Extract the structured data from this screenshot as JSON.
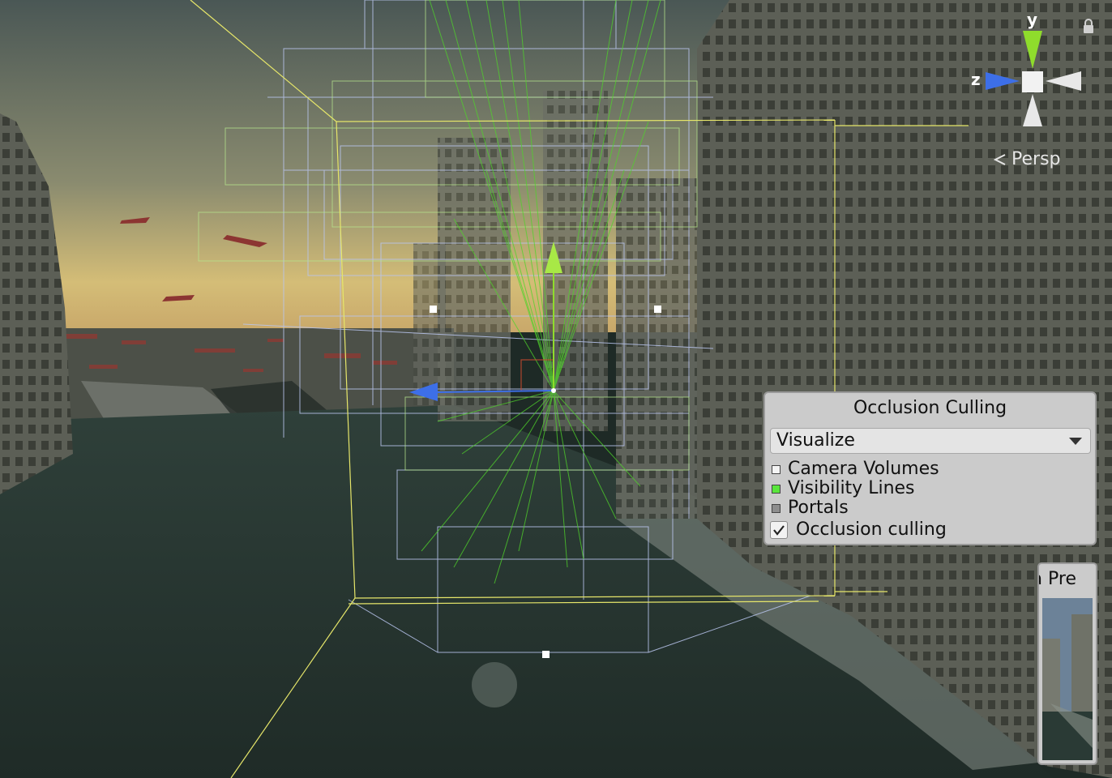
{
  "scene_gizmo": {
    "y_label": "y",
    "z_label": "z",
    "projection_label": "Persp",
    "colors": {
      "y_axis": "#8fdc2c",
      "z_axis": "#3d6fe8",
      "x_axis": "#e8e8e8"
    }
  },
  "occlusion_panel": {
    "title": "Occlusion Culling",
    "mode_value": "Visualize",
    "legend": [
      {
        "label": "Camera Volumes",
        "color": "#f4f4f4"
      },
      {
        "label": "Visibility Lines",
        "color": "#59e63b"
      },
      {
        "label": "Portals",
        "color": "#8e8e8e"
      }
    ],
    "checkbox_label": "Occlusion culling",
    "checkbox_checked": true
  },
  "camera_preview": {
    "title_fragment": "era Pre"
  },
  "colors": {
    "volume_lines": "#b9c5ee",
    "visibility_lines": "#4fd42a",
    "selection_box": "#e6e66a",
    "water": "#2a3a35",
    "sky_top": "#4d5a58",
    "sky_horizon": "#d9c17a"
  }
}
